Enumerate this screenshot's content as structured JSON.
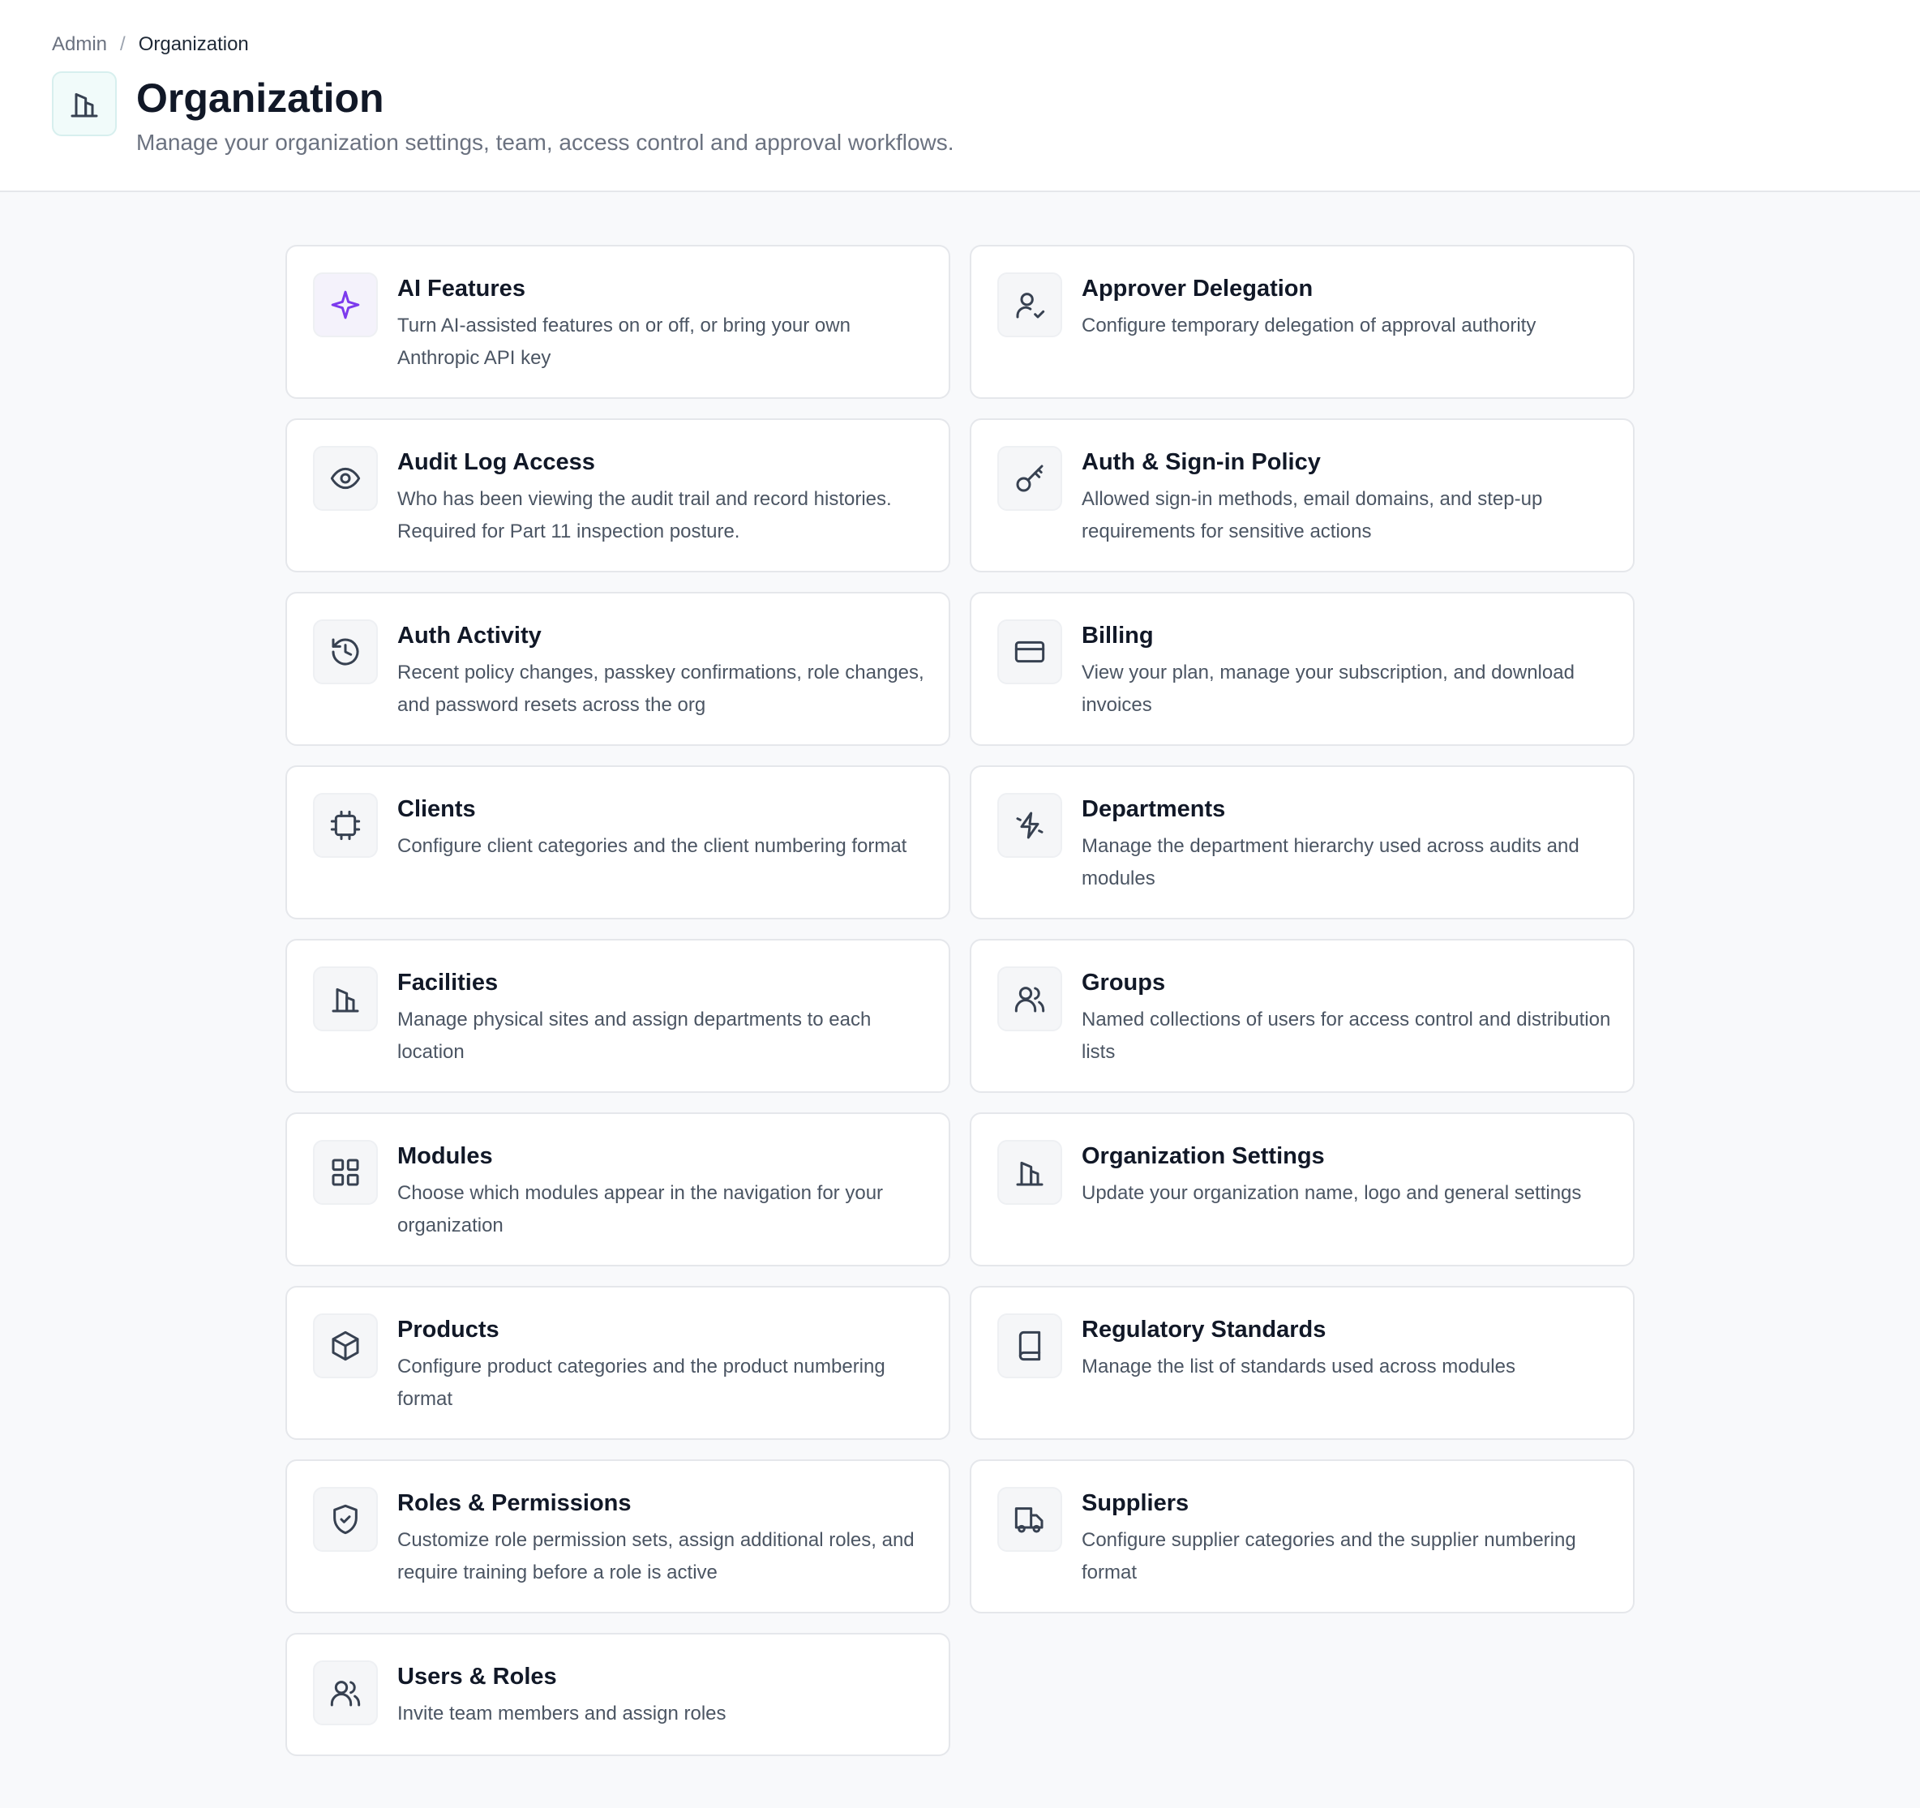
{
  "breadcrumb": {
    "parent": "Admin",
    "separator": "/",
    "current": "Organization"
  },
  "page": {
    "title": "Organization",
    "subtitle": "Manage your organization settings, team, access control and approval workflows.",
    "icon": "building-icon"
  },
  "colors": {
    "accent_purple": "#7c3aed",
    "icon_gray": "#374151",
    "title": "#111827",
    "text_muted": "#4b5563"
  },
  "cards": [
    {
      "title": "AI Features",
      "description": "Turn AI-assisted features on or off, or bring your own Anthropic API key",
      "icon": "sparkle-icon"
    },
    {
      "title": "Approver Delegation",
      "description": "Configure temporary delegation of approval authority",
      "icon": "user-check-icon"
    },
    {
      "title": "Audit Log Access",
      "description": "Who has been viewing the audit trail and record histories. Required for Part 11 inspection posture.",
      "icon": "eye-icon"
    },
    {
      "title": "Auth & Sign-in Policy",
      "description": "Allowed sign-in methods, email domains, and step-up requirements for sensitive actions",
      "icon": "key-icon"
    },
    {
      "title": "Auth Activity",
      "description": "Recent policy changes, passkey confirmations, role changes, and password resets across the org",
      "icon": "history-icon"
    },
    {
      "title": "Billing",
      "description": "View your plan, manage your subscription, and download invoices",
      "icon": "credit-card-icon"
    },
    {
      "title": "Clients",
      "description": "Configure client categories and the client numbering format",
      "icon": "chip-icon"
    },
    {
      "title": "Departments",
      "description": "Manage the department hierarchy used across audits and modules",
      "icon": "zap-icon"
    },
    {
      "title": "Facilities",
      "description": "Manage physical sites and assign departments to each location",
      "icon": "building-icon"
    },
    {
      "title": "Groups",
      "description": "Named collections of users for access control and distribution lists",
      "icon": "users-icon"
    },
    {
      "title": "Modules",
      "description": "Choose which modules appear in the navigation for your organization",
      "icon": "grid-icon"
    },
    {
      "title": "Organization Settings",
      "description": "Update your organization name, logo and general settings",
      "icon": "building-icon"
    },
    {
      "title": "Products",
      "description": "Configure product categories and the product numbering format",
      "icon": "box-icon"
    },
    {
      "title": "Regulatory Standards",
      "description": "Manage the list of standards used across modules",
      "icon": "book-icon"
    },
    {
      "title": "Roles & Permissions",
      "description": "Customize role permission sets, assign additional roles, and require training before a role is active",
      "icon": "shield-check-icon"
    },
    {
      "title": "Suppliers",
      "description": "Configure supplier categories and the supplier numbering format",
      "icon": "truck-icon"
    },
    {
      "title": "Users & Roles",
      "description": "Invite team members and assign roles",
      "icon": "users-icon"
    }
  ]
}
